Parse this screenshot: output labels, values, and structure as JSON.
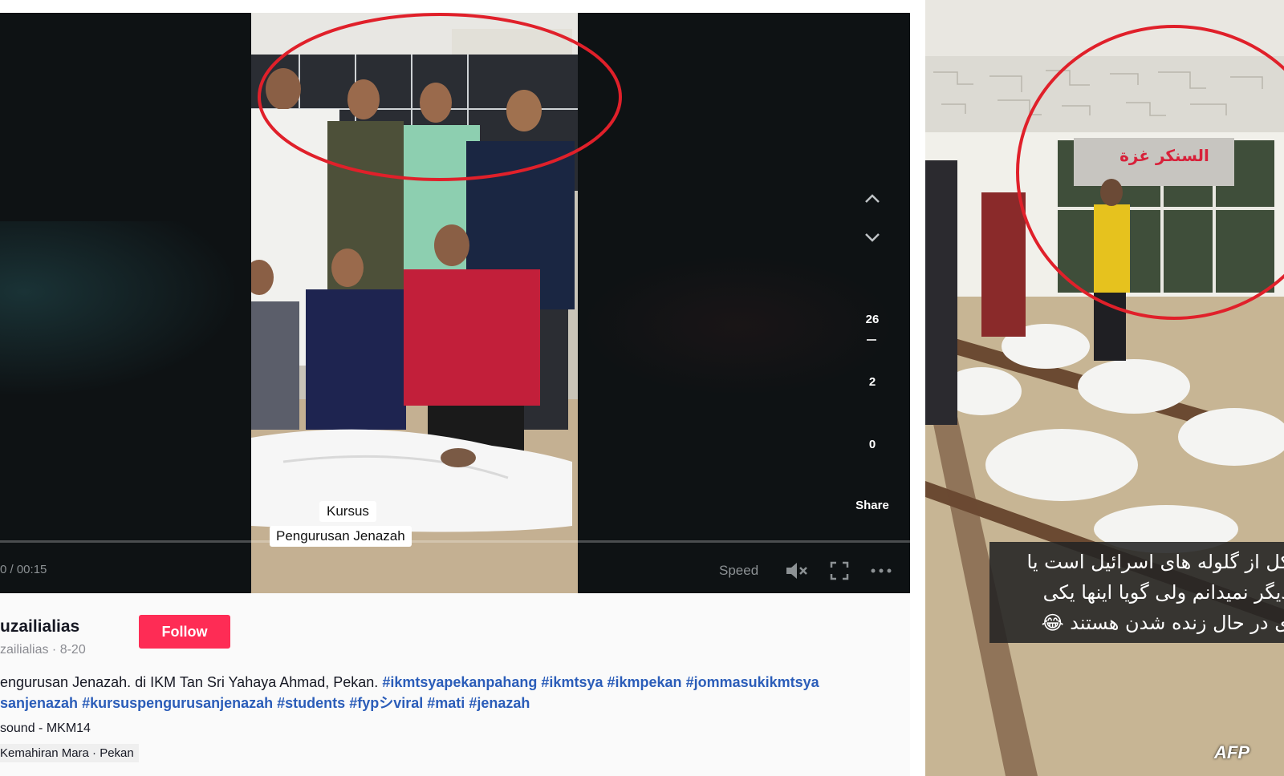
{
  "player": {
    "caption_line1": "Kursus",
    "caption_line2": "Pengurusan Jenazah",
    "time": "0 / 00:15",
    "speed_label": "Speed",
    "like_count": "26",
    "comment_count": "2",
    "save_count": "0",
    "share_label": "Share"
  },
  "post": {
    "username": "uzailialias",
    "handle_date": "zailialias · 8-20",
    "follow_label": "Follow",
    "description_lead": "engurusan Jenazah. di IKM Tan Sri Yahaya Ahmad, Pekan.",
    "tags_line1": [
      "#ikmtsyapekanpahang",
      "#ikmtsya",
      "#ikmpekan",
      "#jommasukikmtsya"
    ],
    "tags_line2": [
      "sanjenazah",
      "#kursuspengurusanjenazah",
      "#students",
      "#fypシviral",
      "#mati",
      "#jenazah"
    ],
    "music": "sound - MKM14",
    "location": "Kemahiran Mara · Pekan"
  },
  "annotation": {
    "circle_color": "#e0202a"
  },
  "right_image": {
    "banner_text": "السنكر غزة",
    "caption_lines": [
      "کل از گلوله های اسرائیل است یا",
      "دیگر نمیدانم ولی گویا اینها یکی",
      "ی در حال زنده شدن هستند 😂"
    ],
    "watermark": "AFP"
  }
}
